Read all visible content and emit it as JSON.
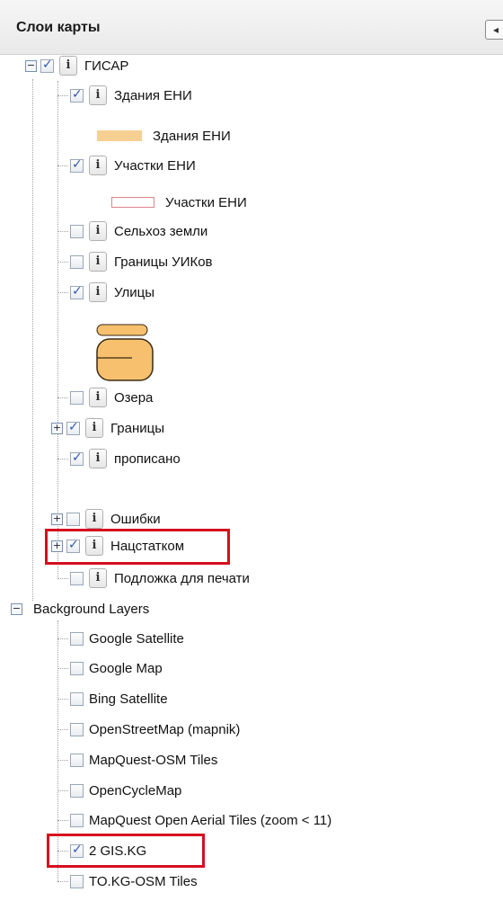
{
  "panel": {
    "title": "Слои карты",
    "collapse_glyph": "◂"
  },
  "tree": {
    "root": {
      "label": "ГИСАР",
      "checked": true,
      "expander": "−"
    },
    "layers": [
      {
        "label": "Здания ЕНИ",
        "checked": true
      },
      {
        "label": "Участки ЕНИ",
        "checked": true
      },
      {
        "label": "Сельхоз земли",
        "checked": false
      },
      {
        "label": "Границы УИКов",
        "checked": false
      },
      {
        "label": "Улицы",
        "checked": true
      },
      {
        "label": "Озера",
        "checked": false
      },
      {
        "label": "Границы",
        "checked": true,
        "expander": "+"
      },
      {
        "label": "прописано",
        "checked": true
      },
      {
        "label": "Ошибки",
        "checked": false,
        "expander": "+"
      },
      {
        "label": "Нацстатком",
        "checked": true,
        "expander": "+"
      },
      {
        "label": "Подложка для печати",
        "checked": false
      }
    ],
    "legends": [
      {
        "label": "Здания ЕНИ",
        "color": "#f6cf92"
      },
      {
        "label": "Участки ЕНИ",
        "color": "#d9848b"
      }
    ],
    "street_colors": {
      "fill": "#f6c06e",
      "stroke": "#3a2a10"
    }
  },
  "background": {
    "label": "Background Layers",
    "expander": "−",
    "layers": [
      {
        "label": "Google Satellite",
        "checked": false
      },
      {
        "label": "Google Map",
        "checked": false
      },
      {
        "label": "Bing Satellite",
        "checked": false
      },
      {
        "label": "OpenStreetMap (mapnik)",
        "checked": false
      },
      {
        "label": "MapQuest-OSM Tiles",
        "checked": false
      },
      {
        "label": "OpenCycleMap",
        "checked": false
      },
      {
        "label": "MapQuest Open Aerial Tiles (zoom < 11)",
        "checked": false
      },
      {
        "label": "2 GIS.KG",
        "checked": true
      },
      {
        "label": "TO.KG-OSM Tiles",
        "checked": false
      }
    ]
  },
  "highlight_color": "#d60e1e"
}
